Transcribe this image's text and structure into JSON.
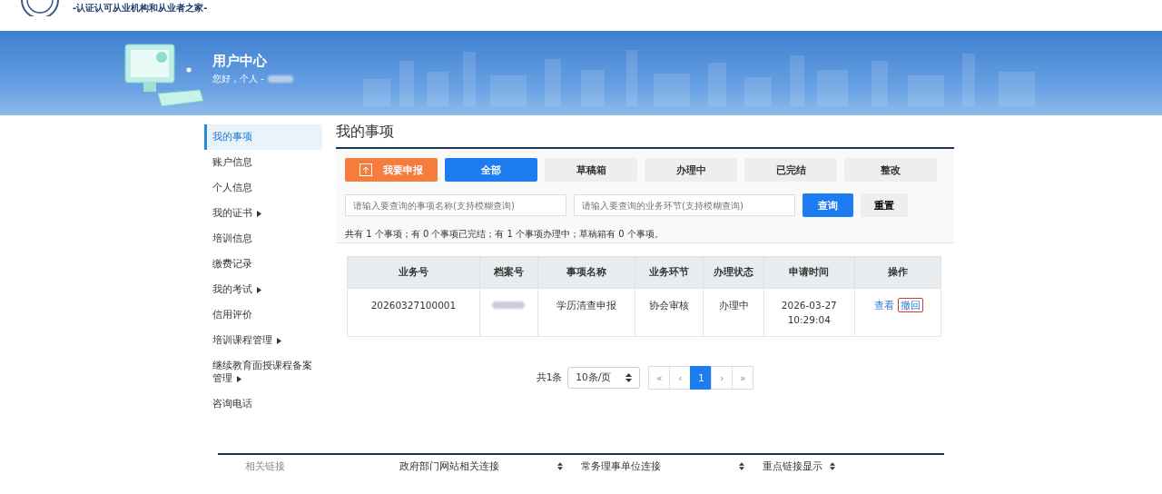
{
  "header": {
    "slogan": "-认证认可从业机构和从业者之家-"
  },
  "banner": {
    "title": "用户中心",
    "greeting": "您好，个人 -"
  },
  "sidebar": {
    "items": [
      {
        "label": "我的事项",
        "selected": true,
        "submenu": false
      },
      {
        "label": "账户信息",
        "selected": false,
        "submenu": false
      },
      {
        "label": "个人信息",
        "selected": false,
        "submenu": false
      },
      {
        "label": "我的证书",
        "selected": false,
        "submenu": true
      },
      {
        "label": "培训信息",
        "selected": false,
        "submenu": false
      },
      {
        "label": "缴费记录",
        "selected": false,
        "submenu": false
      },
      {
        "label": "我的考试",
        "selected": false,
        "submenu": true
      },
      {
        "label": "信用评价",
        "selected": false,
        "submenu": false
      },
      {
        "label": "培训课程管理",
        "selected": false,
        "submenu": true
      },
      {
        "label": "继续教育面授课程备案管理",
        "selected": false,
        "submenu": true
      },
      {
        "label": "咨询电话",
        "selected": false,
        "submenu": false
      }
    ]
  },
  "main": {
    "title": "我的事项",
    "report_button": "我要申报",
    "tabs": [
      {
        "label": "全部",
        "selected": true
      },
      {
        "label": "草稿箱",
        "selected": false
      },
      {
        "label": "办理中",
        "selected": false
      },
      {
        "label": "已完结",
        "selected": false
      },
      {
        "label": "整改",
        "selected": false
      }
    ],
    "search_name": {
      "placeholder": "请输入要查询的事项名称(支持模糊查询)"
    },
    "search_stage": {
      "placeholder": "请输入要查询的业务环节(支持模糊查询)"
    },
    "query_button": "查询",
    "reset_button": "重置",
    "summary": "共有 1 个事项；有 0 个事项已完结；有 1 个事项办理中；草稿箱有 0 个事项。",
    "table": {
      "columns": [
        "业务号",
        "档案号",
        "事项名称",
        "业务环节",
        "办理状态",
        "申请时间",
        "操作"
      ],
      "rows": [
        {
          "business_no": "20260327100001",
          "item_name": "学历清查申报",
          "stage": "协会审核",
          "status": "办理中",
          "applied_date": "2026-03-27",
          "applied_time": "10:29:04",
          "actions": [
            {
              "label": "查看",
              "highlighted": false
            },
            {
              "label": "撤回",
              "highlighted": true
            }
          ]
        }
      ]
    },
    "pagination": {
      "total": "共1条",
      "page_size": "10条/页",
      "pages": [
        {
          "label": "«",
          "selected": false
        },
        {
          "label": "‹",
          "selected": false
        },
        {
          "label": "1",
          "selected": true
        },
        {
          "label": "›",
          "selected": false
        },
        {
          "label": "»",
          "selected": false
        }
      ]
    }
  },
  "footer": {
    "label": "相关链接",
    "selects": [
      "政府部门网站相关连接",
      "常务理事单位连接",
      "重点链接显示"
    ]
  }
}
